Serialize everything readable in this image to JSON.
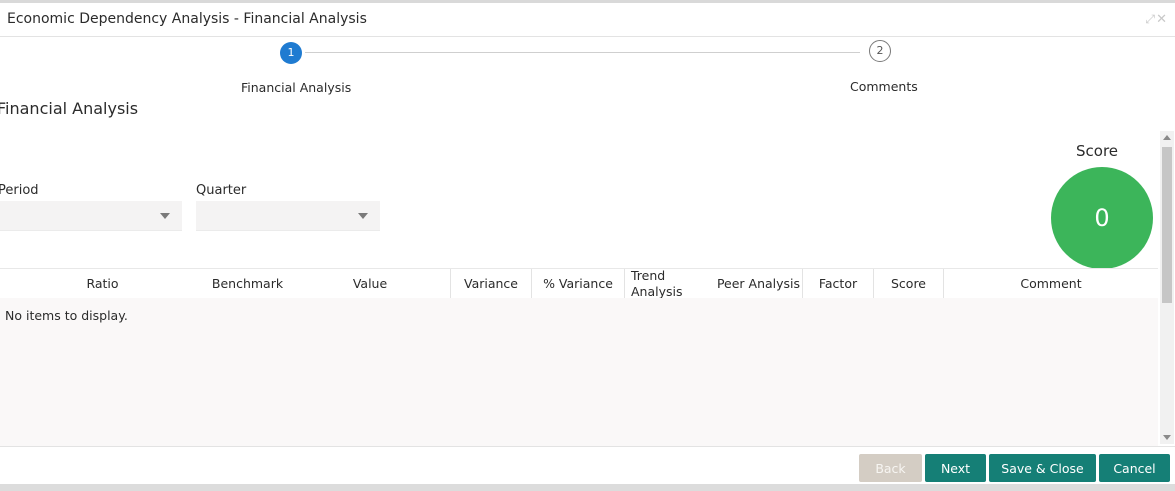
{
  "window": {
    "title": "Economic Dependency Analysis - Financial Analysis",
    "minimize_icon": "collapse-arrows-icon",
    "close_icon": "close-icon"
  },
  "stepper": {
    "steps": [
      {
        "number": "1",
        "label": "Financial Analysis",
        "state": "active",
        "color": "#1f7bd1"
      },
      {
        "number": "2",
        "label": "Comments",
        "state": "pending"
      }
    ]
  },
  "section": {
    "title": "Financial Analysis"
  },
  "filters": {
    "period": {
      "label": "Period",
      "value": ""
    },
    "quarter": {
      "label": "Quarter",
      "value": ""
    }
  },
  "score": {
    "label": "Score",
    "value": "0",
    "color": "#3cb55a"
  },
  "table": {
    "columns": [
      "Ratio",
      "Benchmark",
      "Value",
      "Variance",
      "% Variance",
      "Trend Analysis",
      "Peer Analysis",
      "Factor",
      "Score",
      "Comment"
    ],
    "empty_message": "No items to display.",
    "rows": []
  },
  "footer": {
    "back_label": "Back",
    "next_label": "Next",
    "save_close_label": "Save & Close",
    "cancel_label": "Cancel",
    "accent_color": "#157f76"
  }
}
